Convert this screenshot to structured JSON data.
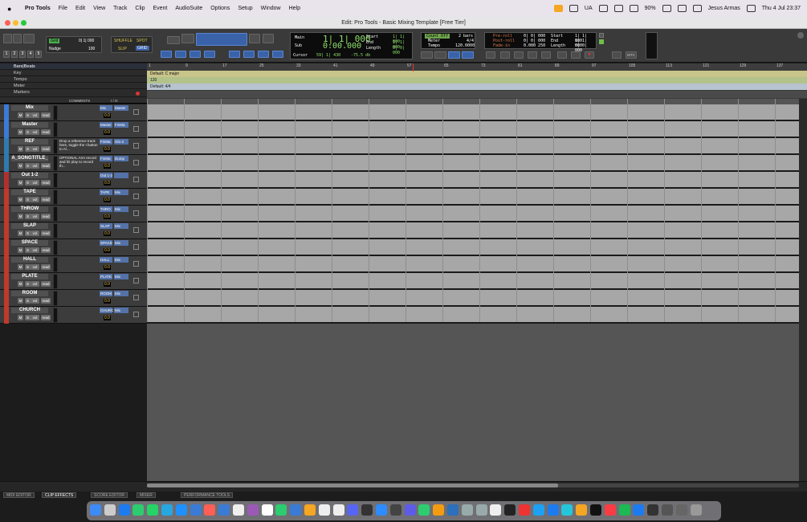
{
  "menubar": {
    "app": "Pro Tools",
    "items": [
      "File",
      "Edit",
      "View",
      "Track",
      "Clip",
      "Event",
      "AudioSuite",
      "Options",
      "Setup",
      "Window",
      "Help"
    ],
    "right": {
      "ua": "UA",
      "battery": "90%",
      "user": "Jesus Armas",
      "clock": "Thu 4 Jul  23:37"
    }
  },
  "window": {
    "title": "Edit: Pro Tools - Basic Mixing Template [Free Tier]"
  },
  "toolbar": {
    "grid_label": "Grid",
    "grid_value": "0| 1| 000",
    "nudge_label": "Nudge",
    "nudge_value": "100",
    "mode_shuffle": "SHUFFLE",
    "mode_spot": "SPOT",
    "mode_slip": "SLIP",
    "mode_grid": "GRID",
    "counter_main_label": "Main",
    "counter_main": "1| 1| 000",
    "counter_sub_label": "Sub",
    "counter_sub": "0:00.000",
    "start_label": "Start",
    "start": "1| 1| 000",
    "end_label": "End",
    "end": "1| 1| 000",
    "length_label": "Length",
    "length": "0| 0| 000",
    "cursor_label": "Cursor",
    "cursor": "59| 1| 430",
    "cursor_db": "-75.5 db",
    "countoff": "Count Off",
    "countoff_val": "2 bars",
    "meter_label": "Meter",
    "meter_val": "4/4",
    "tempo_label": "Tempo",
    "tempo_val": "120.0000",
    "preroll": "Pre-roll",
    "preroll_val": "0| 0| 000",
    "postroll": "Post-roll",
    "postroll_val": "0| 0| 000",
    "fadein": "Fade-in",
    "fadein_val": "0.000 250",
    "start2_val": "1| 1| 000",
    "end2_val": "1| 1| 000",
    "length2_val": "0| 0| 000",
    "mtc": "MTC",
    "nums": [
      "1",
      "2",
      "3",
      "4",
      "5"
    ]
  },
  "rulers": {
    "bars_label": "Bars|Beats",
    "key_label": "Key",
    "tempo_label": "Tempo",
    "meter_label": "Meter",
    "markers_label": "Markers",
    "key_value": "Default: C major",
    "tempo_value": "120",
    "meter_value": "Default: 4/4",
    "ticks": [
      "1",
      "9",
      "17",
      "25",
      "33",
      "41",
      "49",
      "57",
      "65",
      "73",
      "81",
      "89",
      "97",
      "105",
      "113",
      "121",
      "129",
      "137"
    ]
  },
  "columns": {
    "comments": "COMMENTS",
    "io": "I / O"
  },
  "tracks": [
    {
      "name": "Mix",
      "ins1": "Mix",
      "ins2": "Master",
      "vol": "0.0",
      "color": "#3a7bd5",
      "read": "read"
    },
    {
      "name": "Master",
      "ins1": "Master",
      "ins2": "FinMa",
      "vol": "0.0",
      "color": "#3a7bd5",
      "read": "read"
    },
    {
      "name": "REF",
      "ins1": "FinMa",
      "ins2": "Ot1-2",
      "vol": "0.0",
      "color": "#2f7ab0",
      "read": "read",
      "comment": "Drop a reference track here, toggle the I button to A/..."
    },
    {
      "name": "A_SONGTITLE_",
      "ins1": "FinMa",
      "ins2": "Dump",
      "vol": "0.0",
      "color": "#2f7ab0",
      "read": "read",
      "comment": "OPTIONAL Arm record and hit play to record th..."
    },
    {
      "name": "Out 1-2",
      "ins1": "Out 1-2",
      "ins2": "",
      "vol": "0.0",
      "color": "#b03030",
      "read": "read"
    },
    {
      "name": "TAPE",
      "ins1": "TAPE",
      "ins2": "Mix",
      "vol": "0.0",
      "color": "#c0392b",
      "read": "read"
    },
    {
      "name": "THROW",
      "ins1": "THRO",
      "ins2": "Mix",
      "vol": "0.0",
      "color": "#c0392b",
      "read": "read"
    },
    {
      "name": "SLAP",
      "ins1": "SLAP",
      "ins2": "Mix",
      "vol": "0.0",
      "color": "#c0392b",
      "read": "read"
    },
    {
      "name": "SPACE",
      "ins1": "SPACE",
      "ins2": "Mix",
      "vol": "0.0",
      "color": "#c0392b",
      "read": "read"
    },
    {
      "name": "HALL",
      "ins1": "HALL",
      "ins2": "Mix",
      "vol": "0.0",
      "color": "#c0392b",
      "read": "read"
    },
    {
      "name": "PLATE",
      "ins1": "PLATE",
      "ins2": "Mix",
      "vol": "0.0",
      "color": "#c0392b",
      "read": "read"
    },
    {
      "name": "ROOM",
      "ins1": "ROOM",
      "ins2": "Mix",
      "vol": "0.0",
      "color": "#c0392b",
      "read": "read"
    },
    {
      "name": "CHURCH",
      "ins1": "CHURC",
      "ins2": "Mix",
      "vol": "0.0",
      "color": "#c0392b",
      "read": "read"
    }
  ],
  "bottom_tabs": [
    "MIDI EDITOR",
    "CLIP EFFECTS",
    "SCORE EDITOR",
    "MIXER",
    "PERFORMANCE TOOLS"
  ]
}
